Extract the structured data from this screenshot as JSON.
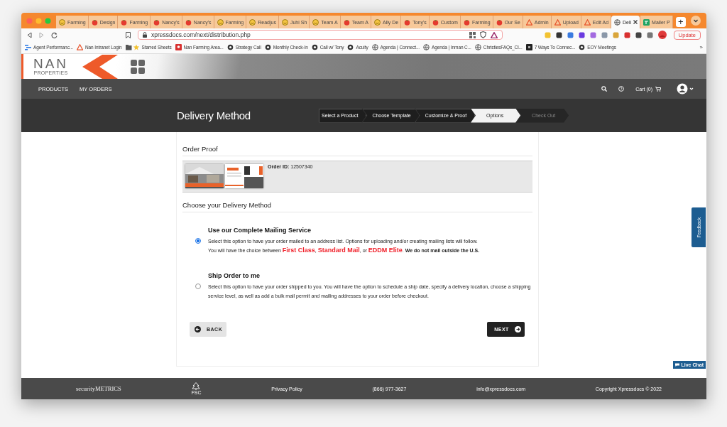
{
  "browser": {
    "tabs": [
      {
        "label": "Farming",
        "kind": "smiley",
        "selected": false
      },
      {
        "label": "Design",
        "kind": "red",
        "selected": false
      },
      {
        "label": "Farming",
        "kind": "red",
        "selected": false
      },
      {
        "label": "Nancy's",
        "kind": "red",
        "selected": false
      },
      {
        "label": "Nancy's",
        "kind": "red",
        "selected": false
      },
      {
        "label": "Farming",
        "kind": "smiley",
        "selected": false
      },
      {
        "label": "Readjus",
        "kind": "smiley",
        "selected": false
      },
      {
        "label": "Juhi Sh",
        "kind": "smiley",
        "selected": false
      },
      {
        "label": "Team A",
        "kind": "smiley",
        "selected": false
      },
      {
        "label": "Team A",
        "kind": "red",
        "selected": false
      },
      {
        "label": "Ally De",
        "kind": "smiley",
        "selected": false
      },
      {
        "label": "Tony's",
        "kind": "red",
        "selected": false
      },
      {
        "label": "Custom",
        "kind": "red",
        "selected": false
      },
      {
        "label": "Farming",
        "kind": "red",
        "selected": false
      },
      {
        "label": "Our Se",
        "kind": "red",
        "selected": false
      },
      {
        "label": "Admin",
        "kind": "triangle",
        "selected": false
      },
      {
        "label": "Upload",
        "kind": "triangle",
        "selected": false
      },
      {
        "label": "Edit Ad",
        "kind": "triangle",
        "selected": false
      },
      {
        "label": "Deli",
        "kind": "globe",
        "selected": true
      },
      {
        "label": "Mailer P",
        "kind": "sheet",
        "selected": false
      }
    ],
    "new_tab": "+",
    "address": "xpressdocs.com/next/distribution.php",
    "update_button": "Update",
    "bookmarks": [
      {
        "label": "Agent Performanc...",
        "kind": "chart"
      },
      {
        "label": "Nan Intranet Login",
        "kind": "triangle"
      },
      {
        "label": "Starred Sheets",
        "kind": "folder"
      },
      {
        "label": "Nan Farming Area...",
        "kind": "pin"
      },
      {
        "label": "Strategy Call",
        "kind": "dark"
      },
      {
        "label": "Monthly Check-In",
        "kind": "dark"
      },
      {
        "label": "Call w/ Tony",
        "kind": "dark"
      },
      {
        "label": "Acuity",
        "kind": "dark"
      },
      {
        "label": "Agenda | Connect...",
        "kind": "globe"
      },
      {
        "label": "Agenda | Inman C...",
        "kind": "globe"
      },
      {
        "label": "ChristiesFAQs_Cl...",
        "kind": "globe"
      },
      {
        "label": "7 Ways To Connec...",
        "kind": "square"
      },
      {
        "label": "EOY Meetings",
        "kind": "dark"
      }
    ],
    "more_bookmarks": "»"
  },
  "site": {
    "logo": "NAN",
    "logo_subtext": "PROPERTIES",
    "nav": [
      "PRODUCTS",
      "MY ORDERS"
    ],
    "cart": "Cart (0)",
    "page_title": "Delivery Method",
    "steps": [
      {
        "label": "Select a Product",
        "kind": "done"
      },
      {
        "label": "Choose Template",
        "kind": "done"
      },
      {
        "label": "Customize & Proof",
        "kind": "done"
      },
      {
        "label": "Options",
        "kind": "current"
      },
      {
        "label": "Check Out",
        "kind": "upcoming"
      }
    ],
    "order_proof": {
      "heading": "Order Proof",
      "order_id_label": "Order ID:",
      "order_id": "12507340"
    },
    "delivery": {
      "heading": "Choose your Delivery Method",
      "options": [
        {
          "title": "Use our Complete Mailing Service",
          "selected": true,
          "lines": [
            [
              {
                "text": "Select this option to have your order mailed to an address list. Options for uploading and/or creating mailing lists will follow.",
                "kind": "plain"
              }
            ],
            [
              {
                "text": "You will have the choice between ",
                "kind": "plain"
              },
              {
                "text": "First Class",
                "kind": "highlight"
              },
              {
                "text": ", ",
                "kind": "plain"
              },
              {
                "text": "Standard Mail",
                "kind": "highlight"
              },
              {
                "text": ", or ",
                "kind": "plain"
              },
              {
                "text": "EDDM Elite",
                "kind": "highlight"
              },
              {
                "text": ". ",
                "kind": "plain"
              },
              {
                "text": "We do not mail outside the U.S.",
                "kind": "bold"
              }
            ]
          ]
        },
        {
          "title": "Ship Order to me",
          "selected": false,
          "lines": [
            [
              {
                "text": "Select this option to have your order shipped to you. You will have the option to schedule a ship date, specify a delivery location, choose a shipping service level, as well as add a bulk mail permit and mailing addresses to your order before checkout.",
                "kind": "plain"
              }
            ]
          ]
        }
      ]
    },
    "back_button": "BACK",
    "next_button": "NEXT",
    "feedback": "Feedback",
    "live_chat": "Live Chat",
    "footer": {
      "brand": "securityMETRICS",
      "fsc": "FSC",
      "links": [
        "Privacy Policy",
        "(866) 977-3627",
        "info@xpressdocs.com",
        "Copyright Xpressdocs © 2022"
      ]
    }
  }
}
